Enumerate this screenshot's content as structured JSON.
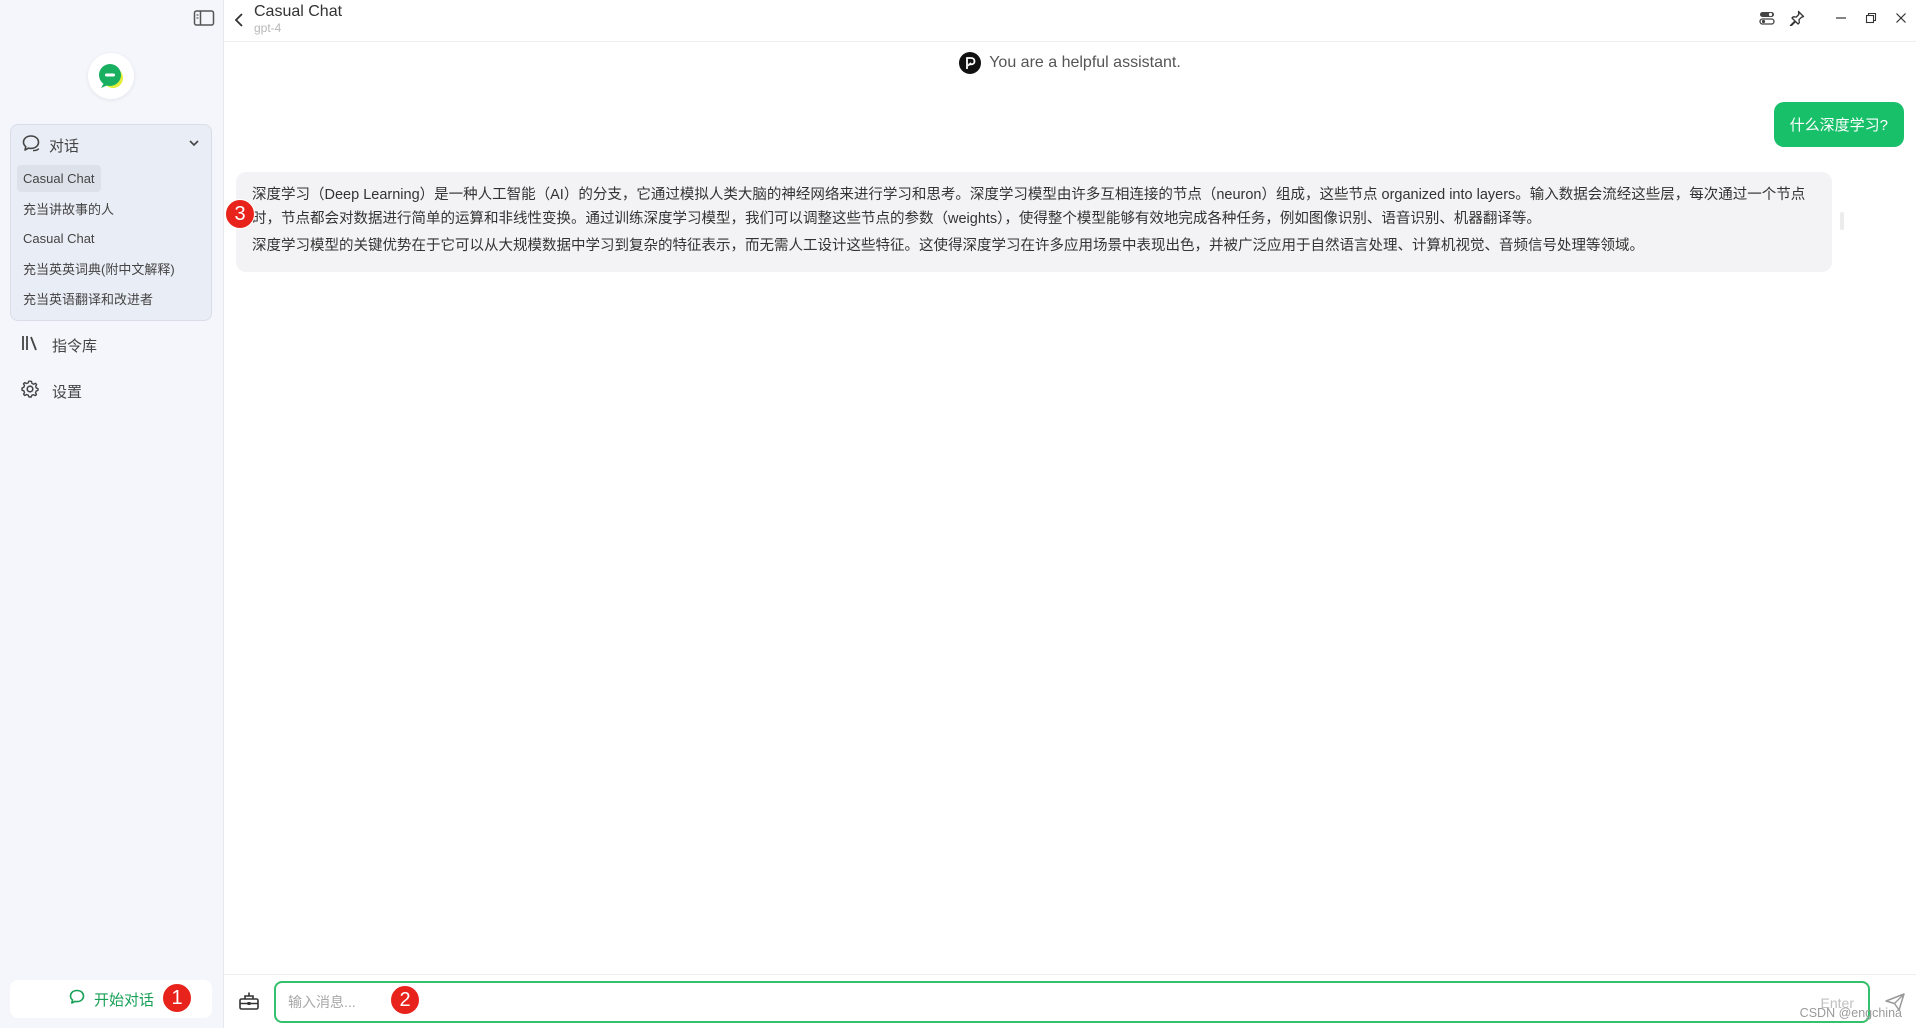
{
  "sidebar": {
    "conversations_label": "对话",
    "conversations": [
      {
        "label": "Casual Chat",
        "active": true
      },
      {
        "label": "充当讲故事的人",
        "active": false
      },
      {
        "label": "Casual Chat",
        "active": false
      },
      {
        "label": "充当英英词典(附中文解释)",
        "active": false
      },
      {
        "label": "充当英语翻译和改进者",
        "active": false
      }
    ],
    "prompt_library_label": "指令库",
    "settings_label": "设置",
    "new_chat_label": "开始对话"
  },
  "header": {
    "title": "Casual Chat",
    "model": "gpt-4"
  },
  "chat": {
    "system_prompt": "You are a helpful assistant.",
    "user_message": "什么深度学习?",
    "assistant_paragraphs": [
      "深度学习（Deep Learning）是一种人工智能（AI）的分支，它通过模拟人类大脑的神经网络来进行学习和思考。深度学习模型由许多互相连接的节点（neuron）组成，这些节点 organized into layers。输入数据会流经这些层，每次通过一个节点时，节点都会对数据进行简单的运算和非线性变换。通过训练深度学习模型，我们可以调整这些节点的参数（weights），使得整个模型能够有效地完成各种任务，例如图像识别、语音识别、机器翻译等。",
      "深度学习模型的关键优势在于它可以从大规模数据中学习到复杂的特征表示，而无需人工设计这些特征。这使得深度学习在许多应用场景中表现出色，并被广泛应用于自然语言处理、计算机视觉、音频信号处理等领域。"
    ]
  },
  "composer": {
    "placeholder": "输入消息...",
    "enter_hint": "Enter"
  },
  "annotations": {
    "badge_1": "1",
    "badge_2": "2",
    "badge_3": "3"
  },
  "watermark": "CSDN @engchina",
  "colors": {
    "accent": "#18a058",
    "user_bubble": "#18c06a",
    "input_border": "#35c06d",
    "badge": "#e8231b"
  }
}
